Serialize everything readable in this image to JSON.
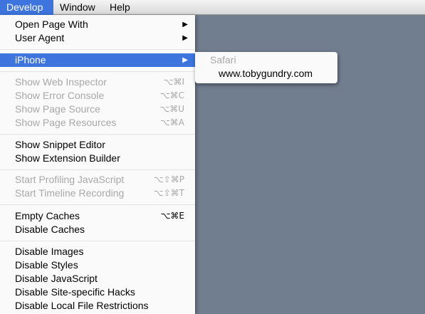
{
  "menubar": {
    "items": [
      "Develop",
      "Window",
      "Help"
    ],
    "active_index": 0
  },
  "develop_menu": {
    "open_page_with": "Open Page With",
    "user_agent": "User Agent",
    "iphone": "iPhone",
    "show_web_inspector": "Show Web Inspector",
    "show_web_inspector_shortcut": "⌥⌘I",
    "show_error_console": "Show Error Console",
    "show_error_console_shortcut": "⌥⌘C",
    "show_page_source": "Show Page Source",
    "show_page_source_shortcut": "⌥⌘U",
    "show_page_resources": "Show Page Resources",
    "show_page_resources_shortcut": "⌥⌘A",
    "show_snippet_editor": "Show Snippet Editor",
    "show_extension_builder": "Show Extension Builder",
    "start_profiling_javascript": "Start Profiling JavaScript",
    "start_profiling_javascript_shortcut": "⌥⇧⌘P",
    "start_timeline_recording": "Start Timeline Recording",
    "start_timeline_recording_shortcut": "⌥⇧⌘T",
    "empty_caches": "Empty Caches",
    "empty_caches_shortcut": "⌥⌘E",
    "disable_caches": "Disable Caches",
    "disable_images": "Disable Images",
    "disable_styles": "Disable Styles",
    "disable_javascript": "Disable JavaScript",
    "disable_site_specific_hacks": "Disable Site-specific Hacks",
    "disable_local_file_restrictions": "Disable Local File Restrictions"
  },
  "iphone_submenu": {
    "header": "Safari",
    "items": [
      "www.tobygundry.com"
    ]
  },
  "colors": {
    "highlight": "#3d74de",
    "desktop": "#717e8f",
    "disabled_text": "#a8a8a8"
  }
}
